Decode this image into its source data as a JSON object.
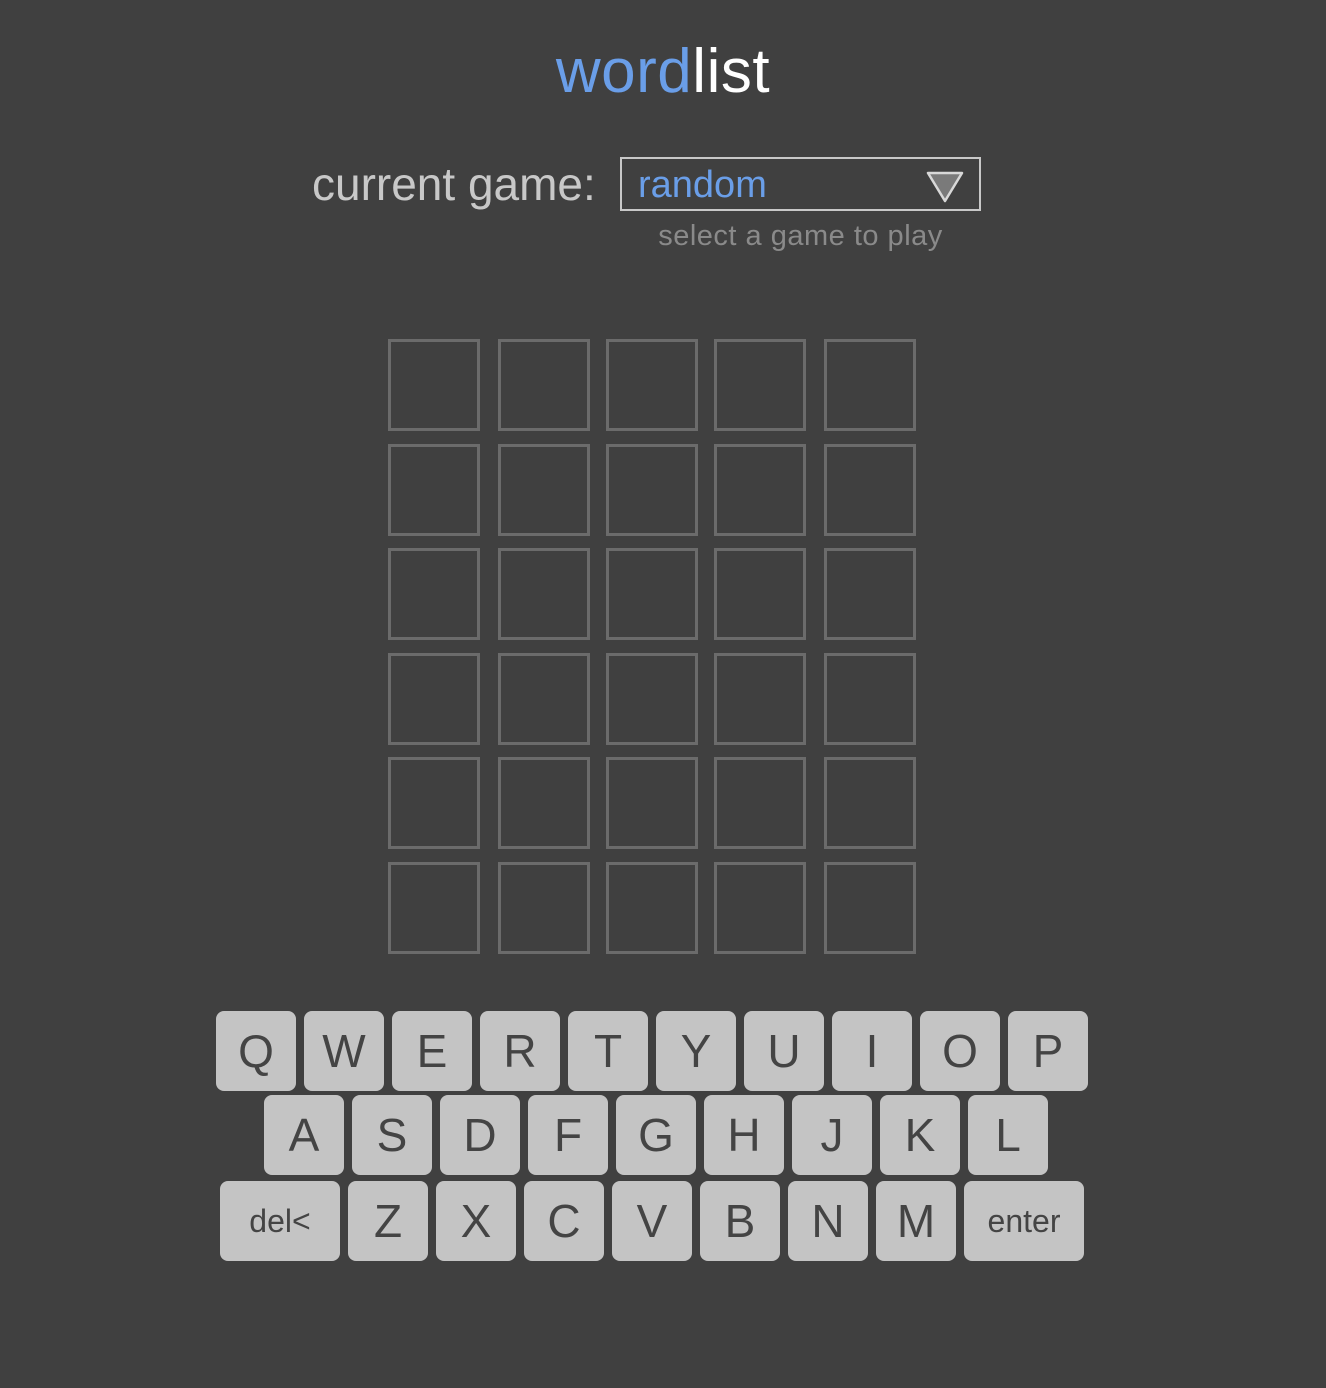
{
  "title": {
    "part_a": "word",
    "part_b": "list"
  },
  "game_selector": {
    "label": "current game:",
    "selected": "random",
    "helper": "select a game to play"
  },
  "board": {
    "rows": [
      [
        "",
        "",
        "",
        "",
        ""
      ],
      [
        "",
        "",
        "",
        "",
        ""
      ],
      [
        "",
        "",
        "",
        "",
        ""
      ],
      [
        "",
        "",
        "",
        "",
        ""
      ],
      [
        "",
        "",
        "",
        "",
        ""
      ],
      [
        "",
        "",
        "",
        "",
        ""
      ]
    ]
  },
  "keyboard": {
    "rows": [
      [
        "Q",
        "W",
        "E",
        "R",
        "T",
        "Y",
        "U",
        "I",
        "O",
        "P"
      ],
      [
        "A",
        "S",
        "D",
        "F",
        "G",
        "H",
        "J",
        "K",
        "L"
      ],
      [
        "del<",
        "Z",
        "X",
        "C",
        "V",
        "B",
        "N",
        "M",
        "enter"
      ]
    ]
  },
  "colors": {
    "background": "#404040",
    "accent": "#6a9ee8",
    "key": "#c4c4c4",
    "tile_border": "#6b6b6b"
  }
}
